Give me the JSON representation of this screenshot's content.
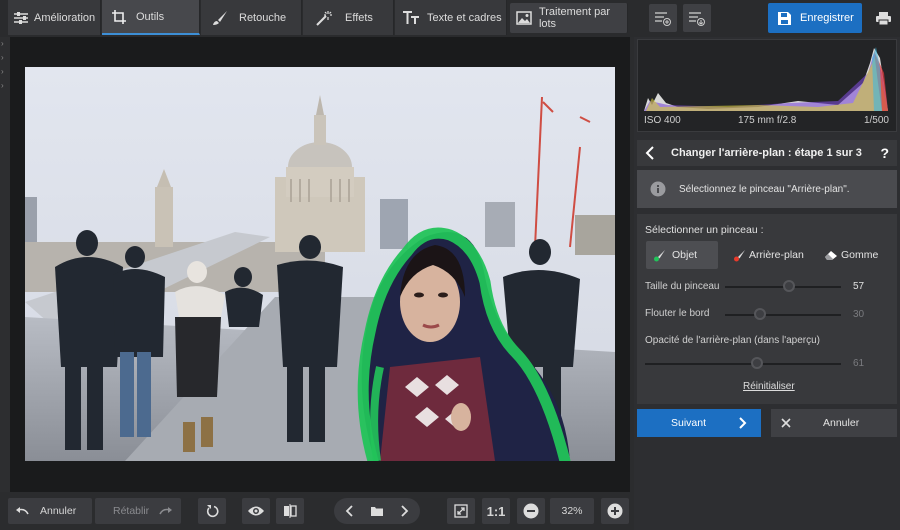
{
  "tabs": [
    {
      "label": "Amélioration",
      "icon": "sliders-icon"
    },
    {
      "label": "Outils",
      "icon": "crop-icon"
    },
    {
      "label": "Retouche",
      "icon": "brush-icon"
    },
    {
      "label": "Effets",
      "icon": "magic-wand-icon"
    },
    {
      "label": "Texte et cadres",
      "icon": "text-icon"
    },
    {
      "label": "Traitement par lots",
      "icon": "image-icon"
    }
  ],
  "toolbar": {
    "save_label": "Enregistrer"
  },
  "histogram": {
    "iso": "ISO 400",
    "lens": "175 mm f/2.8",
    "shutter": "1/500"
  },
  "wizard": {
    "title": "Changer l'arrière-plan : étape 1 sur 3",
    "help": "?",
    "info": "Sélectionnez le pinceau \"Arrière-plan\".",
    "select_label": "Sélectionner un pinceau :",
    "brushes": [
      {
        "label": "Objet",
        "color": "#22c35a"
      },
      {
        "label": "Arrière-plan",
        "color": "#e83a2b"
      },
      {
        "label": "Gomme",
        "color": "#ffffff"
      }
    ],
    "sliders": [
      {
        "label": "Taille du pinceau",
        "value": "57",
        "fraction": 0.56
      },
      {
        "label": "Flouter le bord",
        "value": "30",
        "fraction": 0.3
      },
      {
        "label": "Opacité de l'arrière-plan (dans l'aperçu)",
        "value": "61",
        "fraction": 0.61
      }
    ],
    "reset_label": "Réinitialiser",
    "next_label": "Suivant",
    "cancel_label": "Annuler"
  },
  "bottom": {
    "undo_label": "Annuler",
    "redo_label": "Rétablir",
    "ratio_label": "1:1",
    "zoom": "32%"
  },
  "colors": {
    "accent": "#1c6fc2",
    "object_stroke": "#22c35a"
  }
}
